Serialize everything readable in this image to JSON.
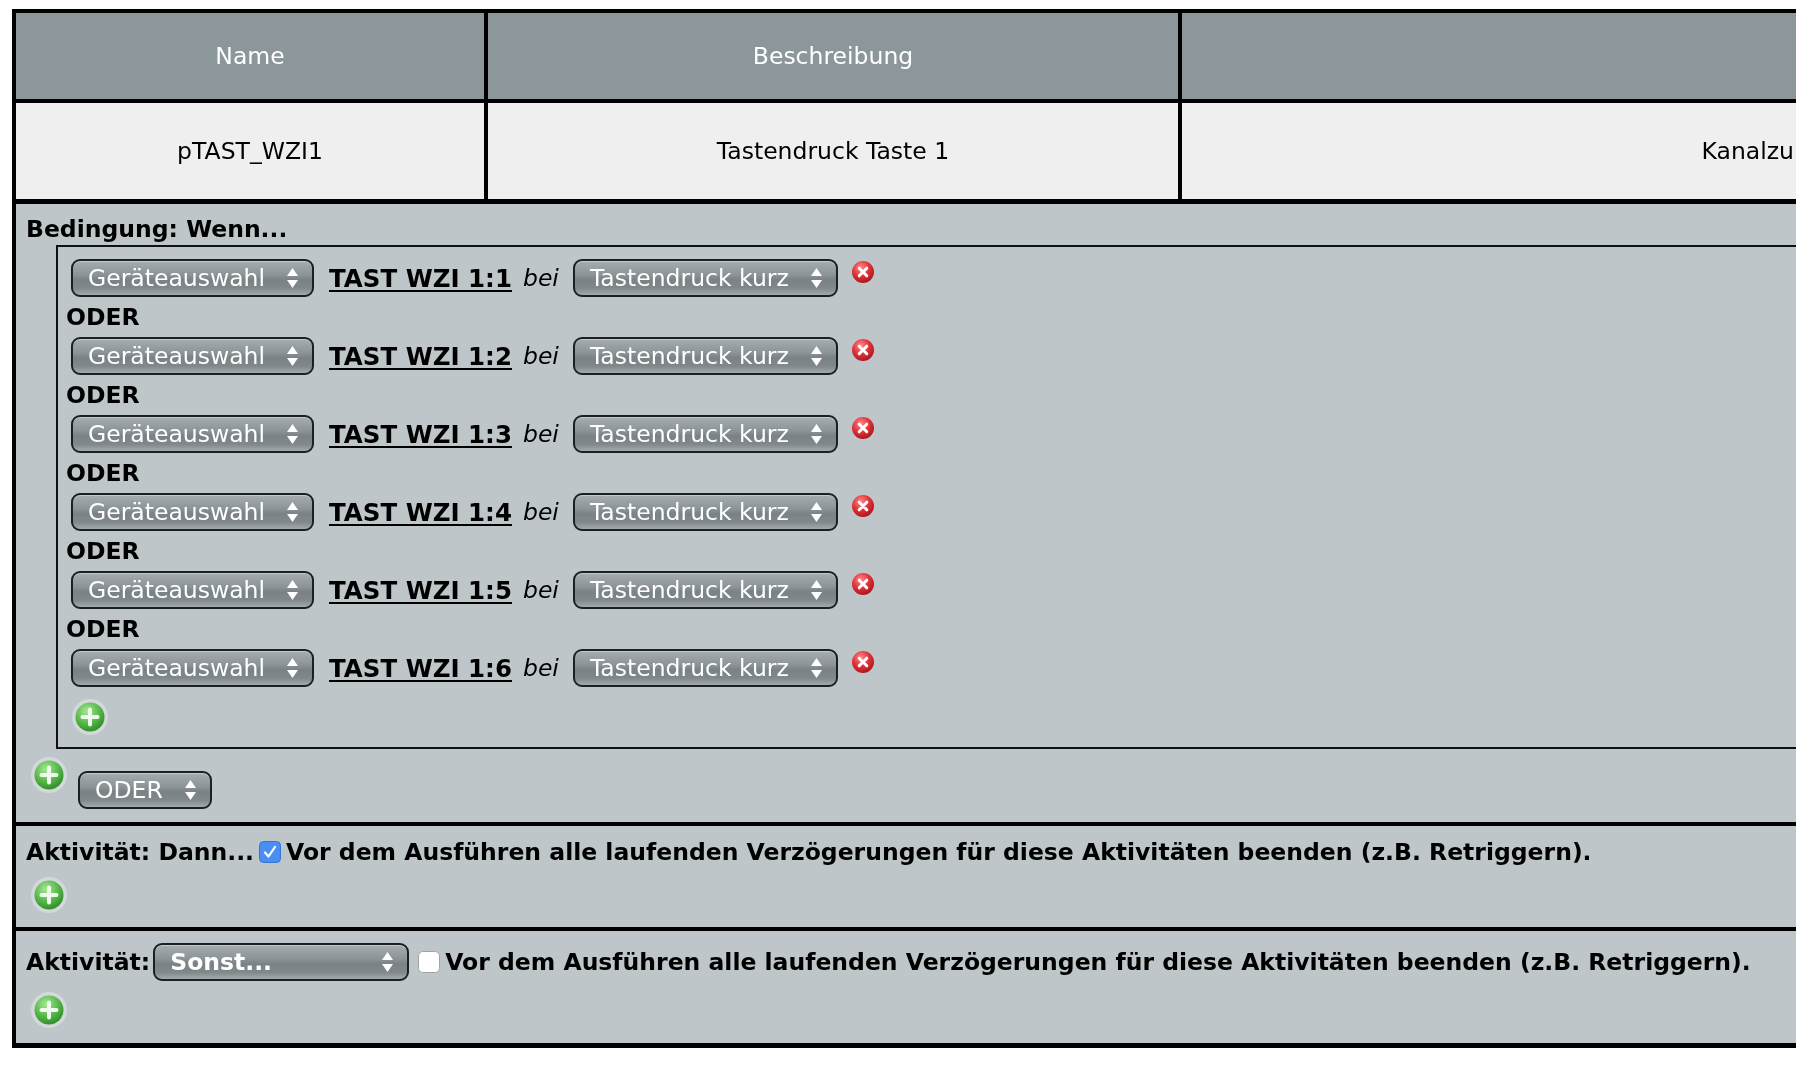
{
  "table": {
    "columns": [
      "Name",
      "Beschreibung"
    ],
    "rows": [
      {
        "cells": [
          "pTAST_WZI1",
          "Tastendruck Taste 1",
          "Kanalzu"
        ]
      }
    ]
  },
  "condition": {
    "title": "Bedingung: Wenn...",
    "groups": [
      {
        "rows": [
          {
            "device_select": "Geräteauswahl",
            "device": "TAST WZI 1:1",
            "connector": "bei",
            "trigger_select": "Tastendruck kurz"
          },
          {
            "operator": "ODER",
            "device_select": "Geräteauswahl",
            "device": "TAST WZI 1:2",
            "connector": "bei",
            "trigger_select": "Tastendruck kurz"
          },
          {
            "operator": "ODER",
            "device_select": "Geräteauswahl",
            "device": "TAST WZI 1:3",
            "connector": "bei",
            "trigger_select": "Tastendruck kurz"
          },
          {
            "operator": "ODER",
            "device_select": "Geräteauswahl",
            "device": "TAST WZI 1:4",
            "connector": "bei",
            "trigger_select": "Tastendruck kurz"
          },
          {
            "operator": "ODER",
            "device_select": "Geräteauswahl",
            "device": "TAST WZI 1:5",
            "connector": "bei",
            "trigger_select": "Tastendruck kurz"
          },
          {
            "operator": "ODER",
            "device_select": "Geräteauswahl",
            "device": "TAST WZI 1:6",
            "connector": "bei",
            "trigger_select": "Tastendruck kurz"
          }
        ]
      }
    ],
    "group_operator_select": "ODER"
  },
  "activities": [
    {
      "kind": "then",
      "title": "Aktivität: Dann...",
      "option": {
        "label": "Vor dem Ausführen alle laufenden Verzögerungen für diese Aktivitäten beenden (z.B. Retriggern).",
        "checked": true
      }
    },
    {
      "kind": "else",
      "title": "Aktivität:",
      "select": "Sonst...",
      "option": {
        "label": "Vor dem Ausführen alle laufenden Verzögerungen für diese Aktivitäten beenden (z.B. Retriggern).",
        "checked": false
      }
    }
  ]
}
